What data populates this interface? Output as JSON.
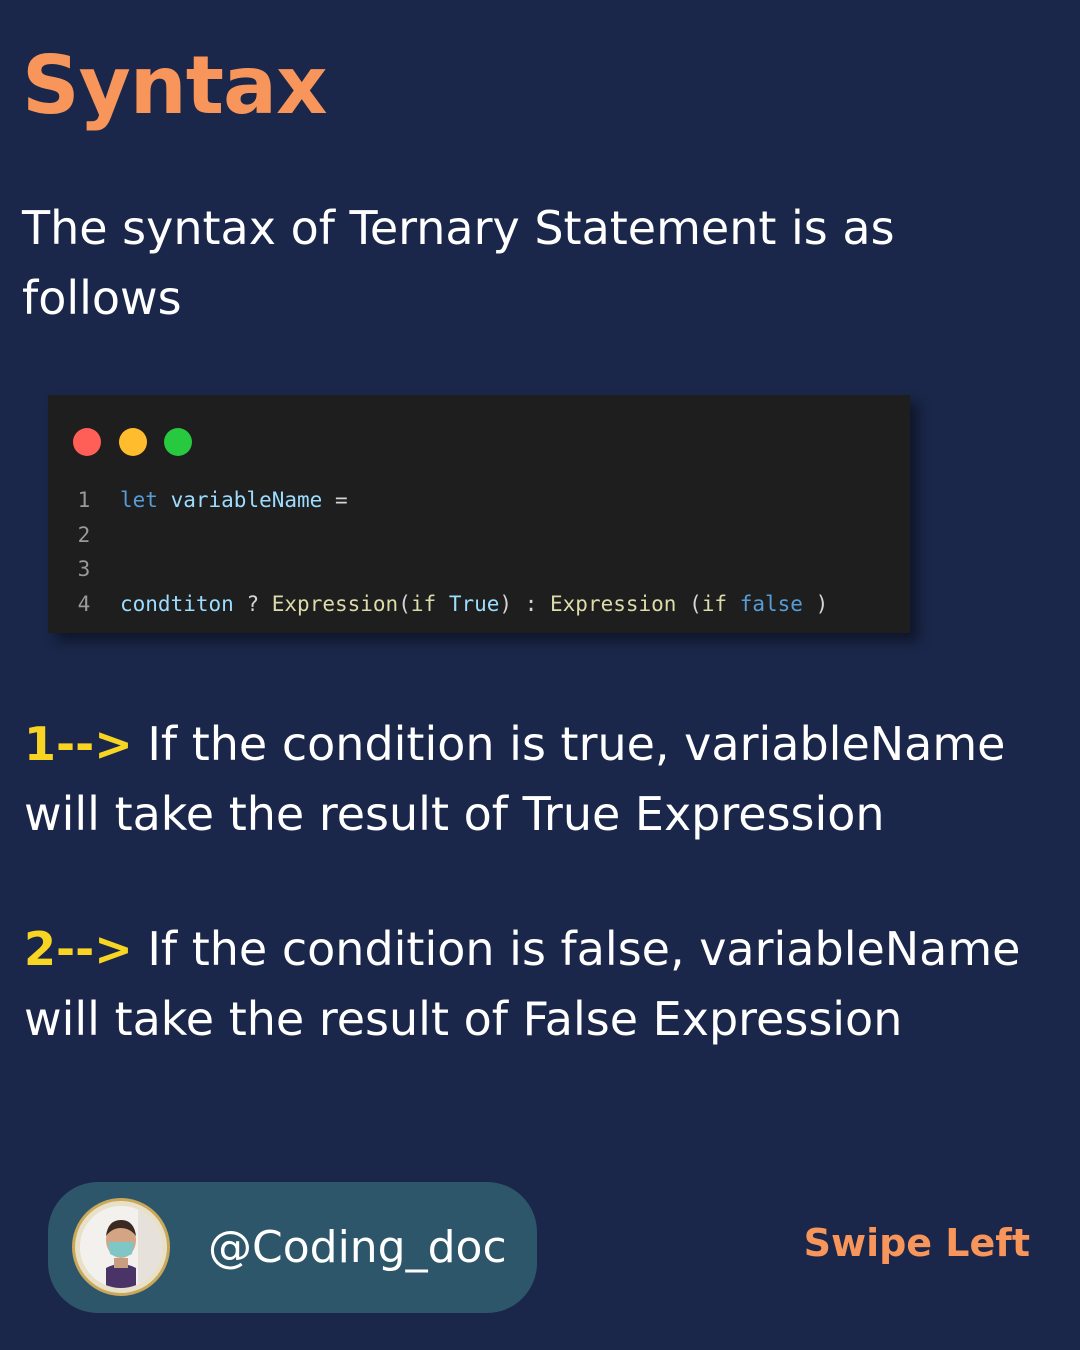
{
  "title": "Syntax",
  "intro": "The syntax of Ternary Statement is as follows",
  "code": {
    "line_numbers": [
      "1",
      "2",
      "3",
      "4"
    ],
    "line1": {
      "keyword": "let",
      "variable": "variableName",
      "operator": "="
    },
    "line4": {
      "condition": "condtiton",
      "question": "?",
      "expr1_name": "Expression",
      "expr1_open": "(",
      "expr1_if": "if",
      "expr1_value": "True",
      "expr1_close": ")",
      "colon": ":",
      "expr2_name": "Expression",
      "expr2_open": "(",
      "expr2_if": "if",
      "expr2_value": "false",
      "expr2_close": ")"
    },
    "window_controls": [
      "close-dot",
      "minimize-dot",
      "maximize-dot"
    ]
  },
  "points": [
    {
      "marker": "1-->",
      "text": "If the condition is true, variableName will take the result of True Expression"
    },
    {
      "marker": "2-->",
      "text": "If the condition is false, variableName will take the result of False Expression"
    }
  ],
  "profile": {
    "handle": "@Coding_doc"
  },
  "swipe_label": "Swipe Left",
  "colors": {
    "background": "#1a274a",
    "title": "#f7955a",
    "marker": "#f9d523",
    "pill": "#2d566b",
    "code_bg": "#1e1e1e"
  }
}
